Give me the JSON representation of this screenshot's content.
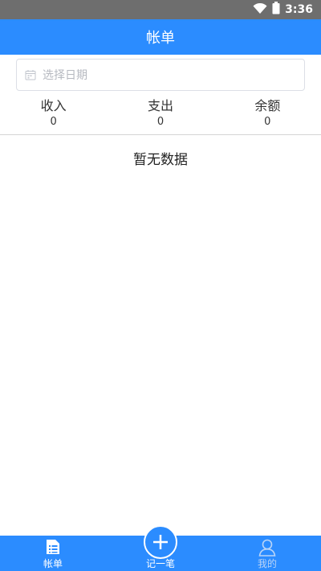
{
  "status_bar": {
    "time": "3:36",
    "icons": [
      "wifi-icon",
      "battery-icon"
    ]
  },
  "header": {
    "title": "帐单"
  },
  "date_picker": {
    "placeholder": "选择日期",
    "icon": "calendar-icon"
  },
  "summary": [
    {
      "label": "收入",
      "value": "0"
    },
    {
      "label": "支出",
      "value": "0"
    },
    {
      "label": "余额",
      "value": "0"
    }
  ],
  "empty_state": {
    "text": "暂无数据"
  },
  "tab_bar": {
    "items": [
      {
        "label": "帐单",
        "icon": "list-icon",
        "active": true
      },
      {
        "label": "记一笔",
        "icon": "plus-icon",
        "active": false
      },
      {
        "label": "我的",
        "icon": "user-icon",
        "active": false
      }
    ]
  },
  "colors": {
    "primary": "#2b8cff",
    "status_bar": "#6e6e6e",
    "inactive_tab": "#b9d4f7"
  }
}
